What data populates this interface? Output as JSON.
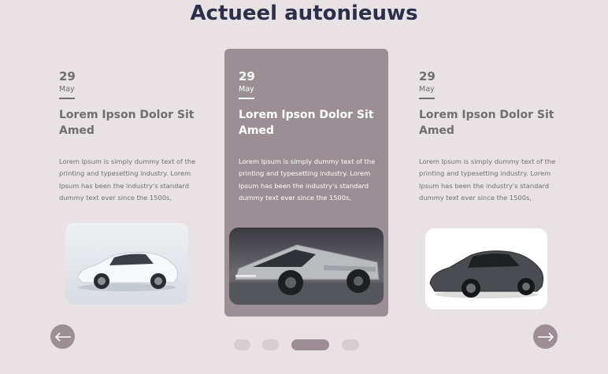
{
  "section": {
    "title": "Actueel autonieuws"
  },
  "cards": [
    {
      "day": "29",
      "month": "May",
      "headline": "Lorem Ipson Dolor Sit Amed",
      "body": "Lorem Ipsum is simply dummy text of the printing and typesetting industry. Lorem Ipsum has been the industry's standard dummy text ever since the 1500s,",
      "image": "white-sedan",
      "active": false
    },
    {
      "day": "29",
      "month": "May",
      "headline": "Lorem Ipson Dolor Sit Amed",
      "body": "Lorem Ipsum is simply dummy text of the printing and typesetting industry. Lorem Ipsum has been the industry's standard dummy text ever since the 1500s,",
      "image": "steel-pickup-truck",
      "active": true
    },
    {
      "day": "29",
      "month": "May",
      "headline": "Lorem Ipson Dolor Sit Amed",
      "body": "Lorem Ipsum is simply dummy text of the printing and typesetting industry. Lorem Ipsum has been the industry's standard dummy text ever since the 1500s,",
      "image": "dark-grey-suv",
      "active": false
    }
  ],
  "navigation": {
    "prev_icon": "arrow-left-icon",
    "next_icon": "arrow-right-icon"
  },
  "pagination": {
    "count": 4,
    "active_index": 2
  },
  "colors": {
    "background": "#e8e2e4",
    "title": "#2b2f4a",
    "text": "#6f6e70",
    "accent": "#9b8e94",
    "dot_inactive": "#d8ced2"
  }
}
